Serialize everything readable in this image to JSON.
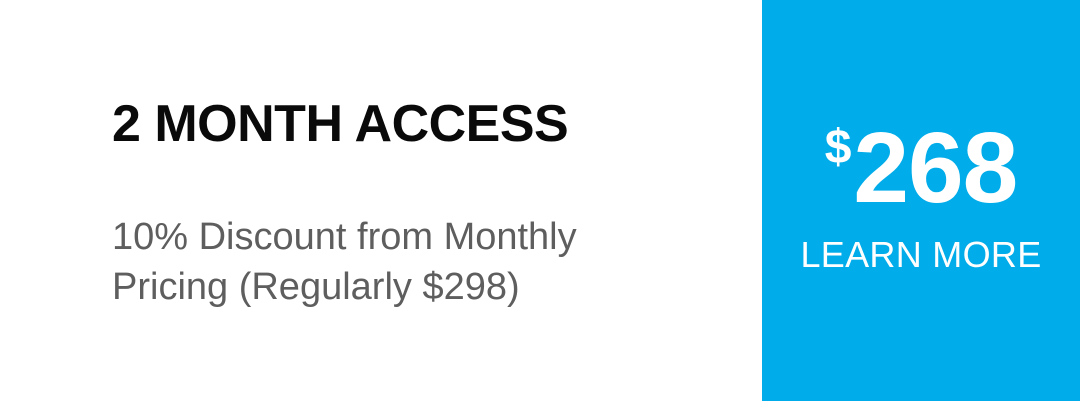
{
  "plan": {
    "title": "2 MONTH ACCESS",
    "description": "10% Discount from Monthly Pricing (Regularly $298)"
  },
  "price": {
    "currency": "$",
    "amount": "268",
    "cta_label": "LEARN MORE"
  },
  "colors": {
    "accent": "#00ace9",
    "title": "#0a0a0a",
    "description": "#5e5e5e",
    "background": "#ffffff"
  }
}
